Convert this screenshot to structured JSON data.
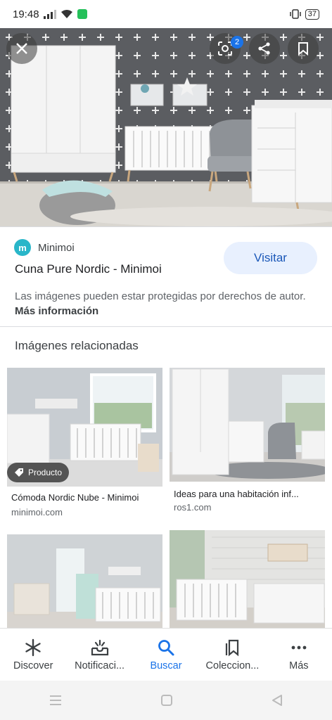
{
  "status_bar": {
    "time": "19:48",
    "battery": "37"
  },
  "overlay": {
    "lens_badge": "2"
  },
  "result": {
    "source_name": "Minimoi",
    "source_logo_letter": "m",
    "title": "Cuna Pure Nordic - Minimoi",
    "visit_label": "Visitar",
    "copyright_text": "Las imágenes pueden estar protegidas por derechos de autor.",
    "more_info_label": "Más información"
  },
  "related": {
    "heading": "Imágenes relacionadas",
    "items": [
      {
        "title": "Cómoda Nordic Nube - Minimoi",
        "source": "minimoi.com",
        "tag": "Producto"
      },
      {
        "title": "Ideas para una habitación inf...",
        "source": "ros1.com"
      },
      {
        "title": "",
        "source": ""
      },
      {
        "title": "",
        "source": ""
      }
    ]
  },
  "bottom_nav": {
    "items": [
      {
        "label": "Discover",
        "icon": "asterisk-icon"
      },
      {
        "label": "Notificaci...",
        "icon": "inbox-bell-icon"
      },
      {
        "label": "Buscar",
        "icon": "search-icon"
      },
      {
        "label": "Coleccion...",
        "icon": "bookmarks-icon"
      },
      {
        "label": "Más",
        "icon": "more-dots-icon"
      }
    ],
    "active_index": 2,
    "accent_color": "#1a73e8"
  }
}
